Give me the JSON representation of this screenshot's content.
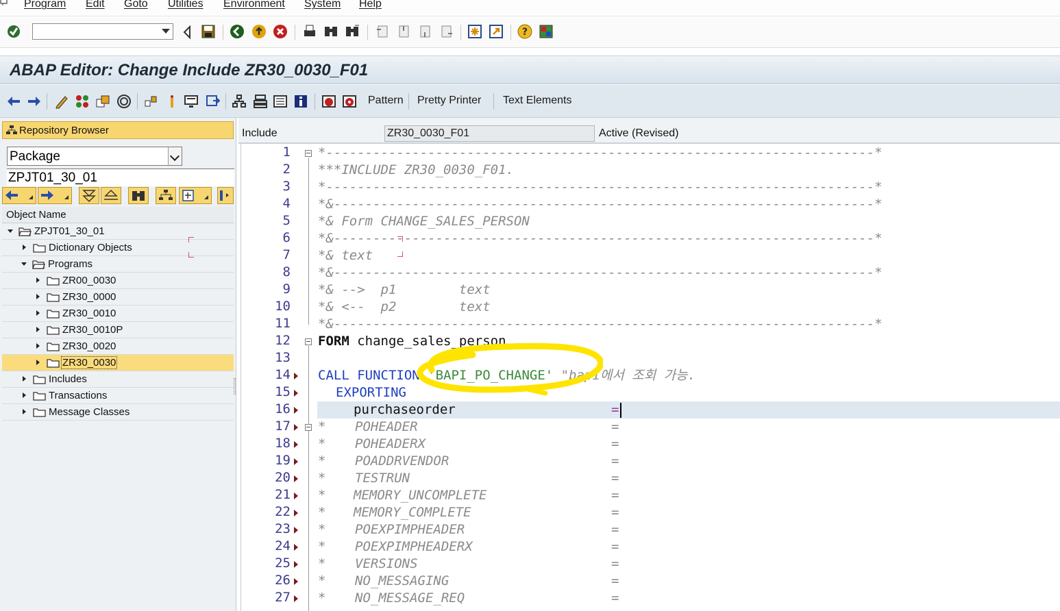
{
  "menubar": {
    "items": [
      "Program",
      "Edit",
      "Goto",
      "Utilities",
      "Environment",
      "System",
      "Help"
    ]
  },
  "std_toolbar": {
    "command_field_value": "",
    "icons": [
      "enter-icon",
      "back-icon",
      "save-icon",
      "back-green-icon",
      "exit-icon",
      "cancel-icon",
      "print-icon",
      "find-icon",
      "find-next-icon",
      "first-page-icon",
      "previous-page-icon",
      "next-page-icon",
      "last-page-icon",
      "create-session-icon",
      "shortcut-icon",
      "help-icon",
      "customize-layout-icon"
    ]
  },
  "title": "ABAP Editor: Change Include ZR30_0030_F01",
  "app_toolbar": {
    "pattern_label": "Pattern",
    "pretty_printer_label": "Pretty Printer",
    "text_elements_label": "Text Elements"
  },
  "left_panel": {
    "repo_browser_label": "Repository Browser",
    "object_type": "Package",
    "package_name": "ZPJT01_30_01",
    "object_name_header": "Object Name",
    "tree": [
      {
        "label": "ZPJT01_30_01",
        "level": 0,
        "expanded": true,
        "selected": false
      },
      {
        "label": "Dictionary Objects",
        "level": 1,
        "expanded": false,
        "selected": false
      },
      {
        "label": "Programs",
        "level": 1,
        "expanded": true,
        "selected": false
      },
      {
        "label": "ZR00_0030",
        "level": 2,
        "expanded": false,
        "selected": false
      },
      {
        "label": "ZR30_0000",
        "level": 2,
        "expanded": false,
        "selected": false
      },
      {
        "label": "ZR30_0010",
        "level": 2,
        "expanded": false,
        "selected": false
      },
      {
        "label": "ZR30_0010P",
        "level": 2,
        "expanded": false,
        "selected": false
      },
      {
        "label": "ZR30_0020",
        "level": 2,
        "expanded": false,
        "selected": false
      },
      {
        "label": "ZR30_0030",
        "level": 2,
        "expanded": false,
        "selected": true
      },
      {
        "label": "Includes",
        "level": 1,
        "expanded": false,
        "selected": false
      },
      {
        "label": "Transactions",
        "level": 1,
        "expanded": false,
        "selected": false
      },
      {
        "label": "Message Classes",
        "level": 1,
        "expanded": false,
        "selected": false
      }
    ]
  },
  "include_header": {
    "label": "Include",
    "value": "ZR30_0030_F01",
    "status": "Active (Revised)"
  },
  "editor": {
    "line_numbers": [
      "1",
      "2",
      "3",
      "4",
      "5",
      "6",
      "7",
      "8",
      "9",
      "10",
      "11",
      "12",
      "13",
      "14",
      "15",
      "16",
      "17",
      "18",
      "19",
      "20",
      "21",
      "22",
      "23",
      "24",
      "25",
      "26",
      "27"
    ],
    "lines": {
      "l1": "*----------------------------------------------------------------------*",
      "l2": "***INCLUDE ZR30_0030_F01.",
      "l3": "*----------------------------------------------------------------------*",
      "l4": "*&---------------------------------------------------------------------*",
      "l5": "*& Form CHANGE_SALES_PERSON",
      "l6": "*&---------------------------------------------------------------------*",
      "l7": "*& text",
      "l8": "*&---------------------------------------------------------------------*",
      "l9": "*& -->  p1        text",
      "l10": "*& <--  p2        text",
      "l11": "*&---------------------------------------------------------------------*",
      "l12_kw": "FORM",
      "l12_rest": " change_sales_person .",
      "l14_kw": "CALL FUNCTION",
      "l14_str": "'BAPI_PO_CHANGE'",
      "l14_comment": "\"bapi에서 조회 가능.",
      "l15_kw": "EXPORTING",
      "l16_param": "purchaseorder",
      "eq": "=",
      "params_commented": [
        "POHEADER",
        "POHEADERX",
        "POADDRVENDOR",
        "TESTRUN",
        "MEMORY_UNCOMPLETE",
        "MEMORY_COMPLETE",
        "POEXPIMPHEADER",
        "POEXPIMPHEADERX",
        "VERSIONS",
        "NO_MESSAGING",
        "NO_MESSAGE_REQ"
      ]
    }
  }
}
